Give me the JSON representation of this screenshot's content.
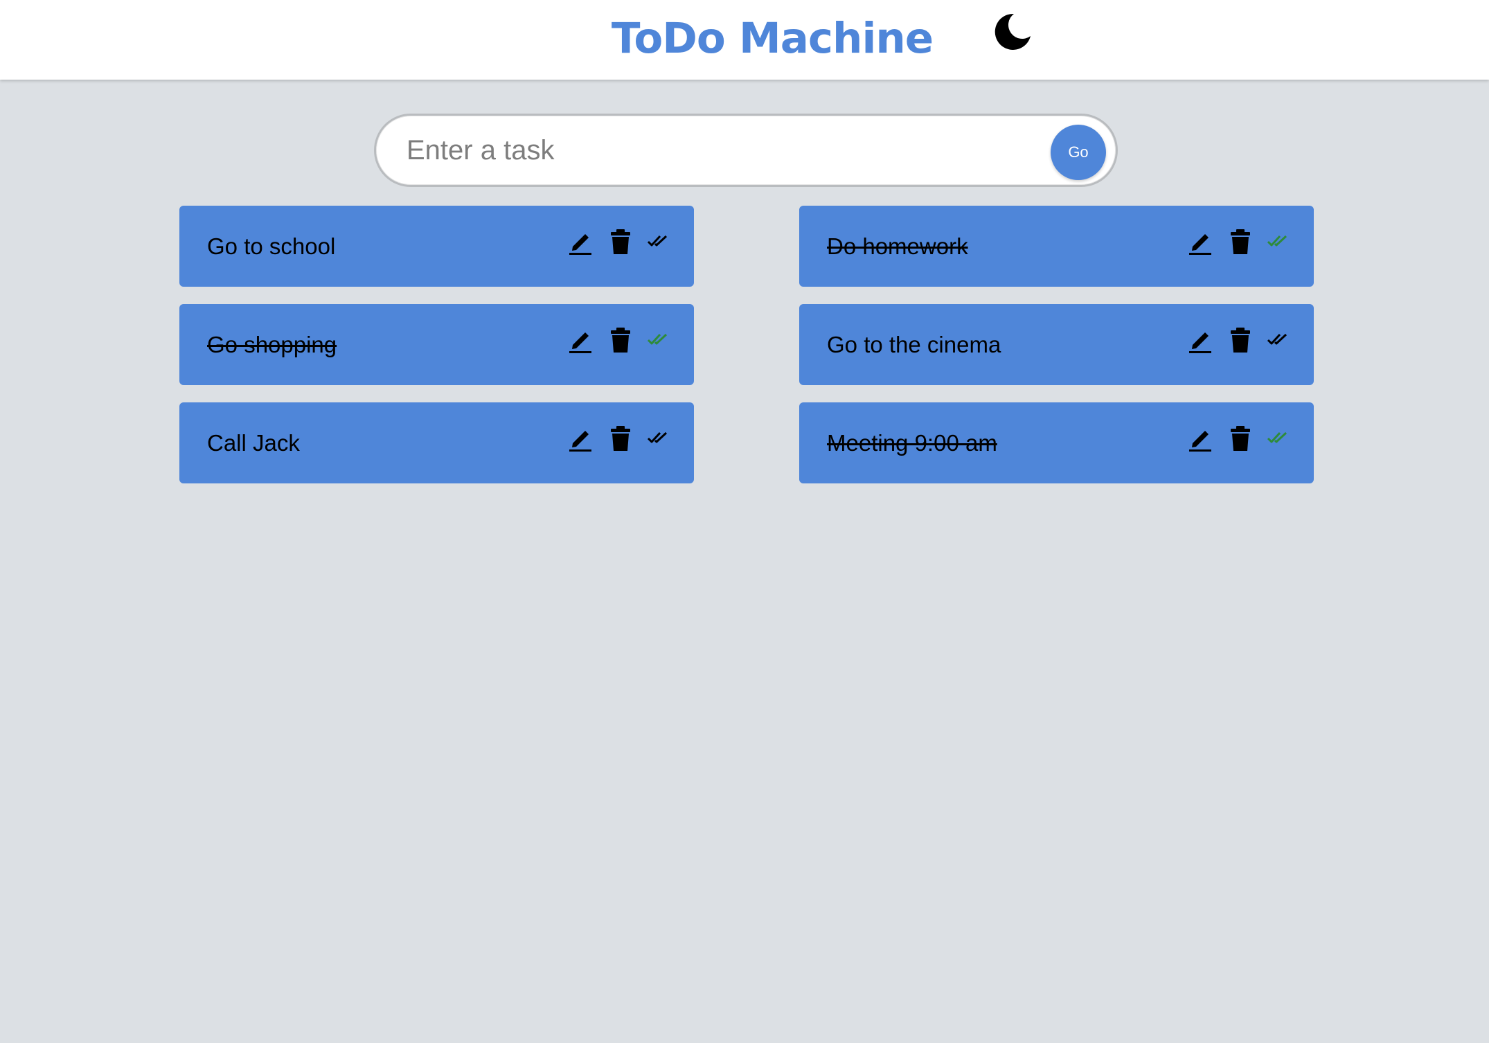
{
  "app": {
    "title": "ToDo Machine"
  },
  "theme_toggle": {
    "icon": "moon-icon"
  },
  "task_input": {
    "placeholder": "Enter a task",
    "value": ""
  },
  "go_button": {
    "label": "Go"
  },
  "colors": {
    "accent": "#4f86d9",
    "background": "#dce0e4",
    "completed_check": "#2e8b3a",
    "pending_check": "#000000"
  },
  "tasks": [
    {
      "text": "Go to school",
      "completed": false
    },
    {
      "text": "Do homework",
      "completed": true
    },
    {
      "text": "Go shopping",
      "completed": true
    },
    {
      "text": "Go to the cinema",
      "completed": false
    },
    {
      "text": "Call Jack",
      "completed": false
    },
    {
      "text": "Meeting 9:00 am",
      "completed": true
    }
  ],
  "task_actions": {
    "edit_icon": "pencil-icon",
    "delete_icon": "trash-icon",
    "complete_icon": "double-check-icon"
  }
}
